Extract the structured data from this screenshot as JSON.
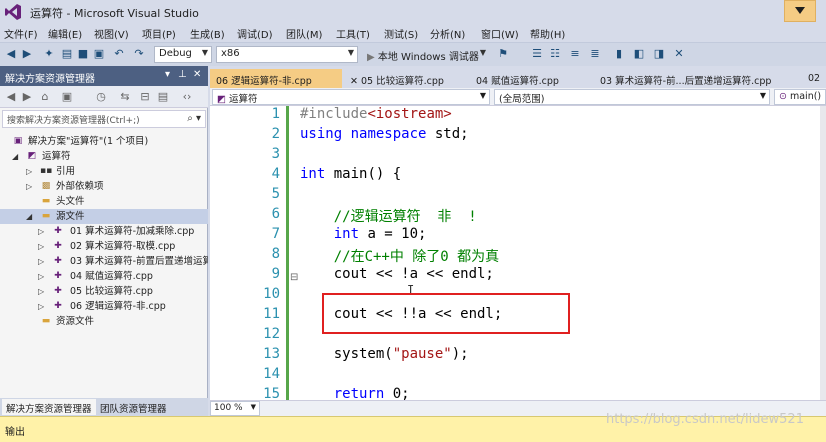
{
  "window": {
    "title": "运算符 - Microsoft Visual Studio"
  },
  "menu": [
    "文件(F)",
    "编辑(E)",
    "视图(V)",
    "项目(P)",
    "生成(B)",
    "调试(D)",
    "团队(M)",
    "工具(T)",
    "测试(S)",
    "分析(N)",
    "窗口(W)",
    "帮助(H)"
  ],
  "toolbar": {
    "config": "Debug",
    "platform": "x86",
    "debugger": "本地 Windows 调试器"
  },
  "solution_explorer": {
    "title": "解决方案资源管理器",
    "search_placeholder": "搜索解决方案资源管理器(Ctrl+;)",
    "items": [
      {
        "label": "解决方案\"运算符\"(1 个项目)",
        "icon": "solution-icon",
        "expander": ""
      },
      {
        "label": "运算符",
        "icon": "project-icon",
        "expander": "◢"
      },
      {
        "label": "引用",
        "icon": "references-icon",
        "expander": "▷"
      },
      {
        "label": "外部依赖项",
        "icon": "external-deps-icon",
        "expander": "▷"
      },
      {
        "label": "头文件",
        "icon": "folder-icon",
        "expander": ""
      },
      {
        "label": "源文件",
        "icon": "folder-icon",
        "expander": "◢"
      },
      {
        "label": "01 算术运算符-加减乘除.cpp",
        "icon": "cpp-file-icon",
        "expander": "▷"
      },
      {
        "label": "02 算术运算符-取模.cpp",
        "icon": "cpp-file-icon",
        "expander": "▷"
      },
      {
        "label": "03 算术运算符-前置后置递增运算",
        "icon": "cpp-file-icon",
        "expander": "▷"
      },
      {
        "label": "04 赋值运算符.cpp",
        "icon": "cpp-file-icon",
        "expander": "▷"
      },
      {
        "label": "05 比较运算符.cpp",
        "icon": "cpp-file-icon",
        "expander": "▷"
      },
      {
        "label": "06 逻辑运算符-非.cpp",
        "icon": "cpp-file-icon",
        "expander": "▷"
      },
      {
        "label": "资源文件",
        "icon": "folder-icon",
        "expander": ""
      }
    ],
    "bottom_tabs": [
      "解决方案资源管理器",
      "团队资源管理器"
    ]
  },
  "doc_tabs": [
    "06 逻辑运算符-非.cpp",
    "05 比较运算符.cpp",
    "04 赋值运算符.cpp",
    "03 算术运算符-前...后置递增运算符.cpp",
    "02"
  ],
  "nav": {
    "project": "运算符",
    "scope": "(全局范围)",
    "member": "main()"
  },
  "code": {
    "line_numbers": [
      "1",
      "2",
      "3",
      "4",
      "5",
      "6",
      "7",
      "8",
      "9",
      "10",
      "11",
      "12",
      "13",
      "14",
      "15"
    ]
  },
  "zoom": "100 %",
  "output_label": "输出",
  "watermark": "https://blog.csdn.net/lidew521"
}
